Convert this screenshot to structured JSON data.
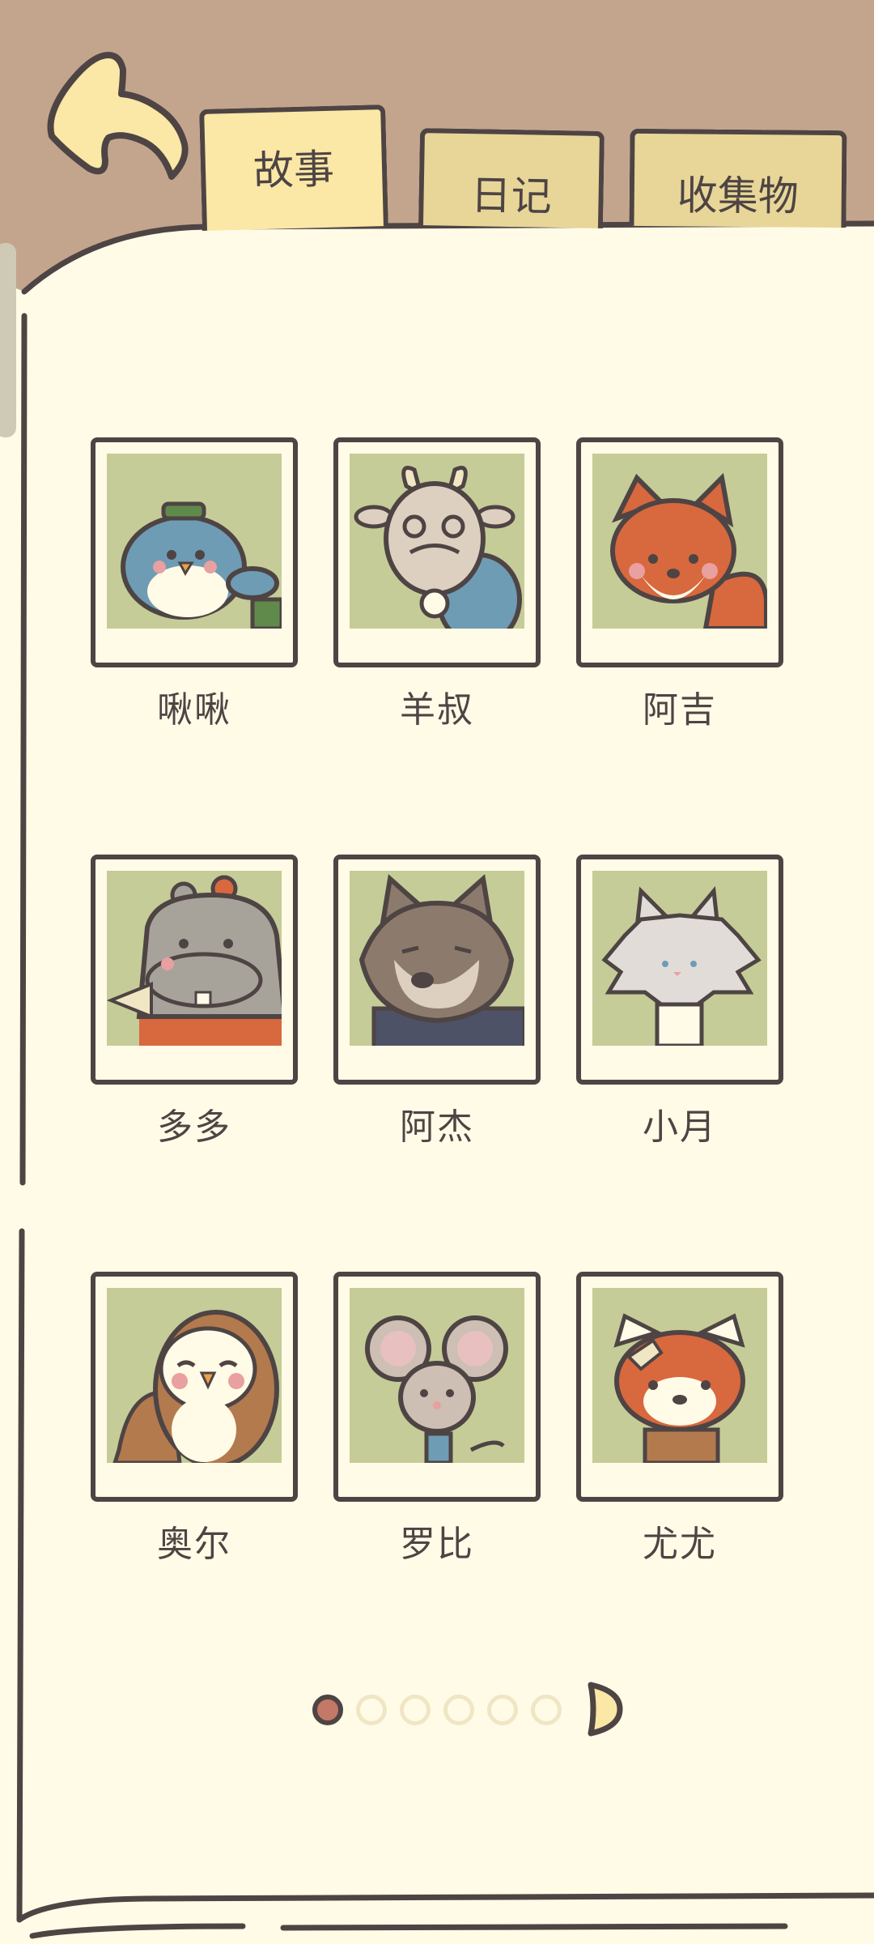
{
  "tabs": [
    {
      "label": "故事",
      "active": true
    },
    {
      "label": "日记",
      "active": false
    },
    {
      "label": "收集物",
      "active": false
    }
  ],
  "back_button": {
    "icon": "curved-back-arrow-icon"
  },
  "characters": [
    {
      "name": "啾啾",
      "portrait": "blue-bird-portrait"
    },
    {
      "name": "羊叔",
      "portrait": "goat-portrait"
    },
    {
      "name": "阿吉",
      "portrait": "fox-portrait"
    },
    {
      "name": "多多",
      "portrait": "hippo-portrait"
    },
    {
      "name": "阿杰",
      "portrait": "wolf-portrait"
    },
    {
      "name": "小月",
      "portrait": "white-cat-portrait"
    },
    {
      "name": "奥尔",
      "portrait": "owl-portrait"
    },
    {
      "name": "罗比",
      "portrait": "mouse-portrait"
    },
    {
      "name": "尤尤",
      "portrait": "red-panda-portrait"
    }
  ],
  "pagination": {
    "total_pages": 6,
    "current_page": 1
  },
  "colors": {
    "background": "#c3a58e",
    "paper": "#fffbe7",
    "ink": "#4e4444",
    "photo_bg": "#c5cc98",
    "tab_active": "#fbe7a6",
    "tab_inactive": "#e8d698",
    "dot_active": "#c47868",
    "dot_inactive": "#f1e6c4"
  }
}
